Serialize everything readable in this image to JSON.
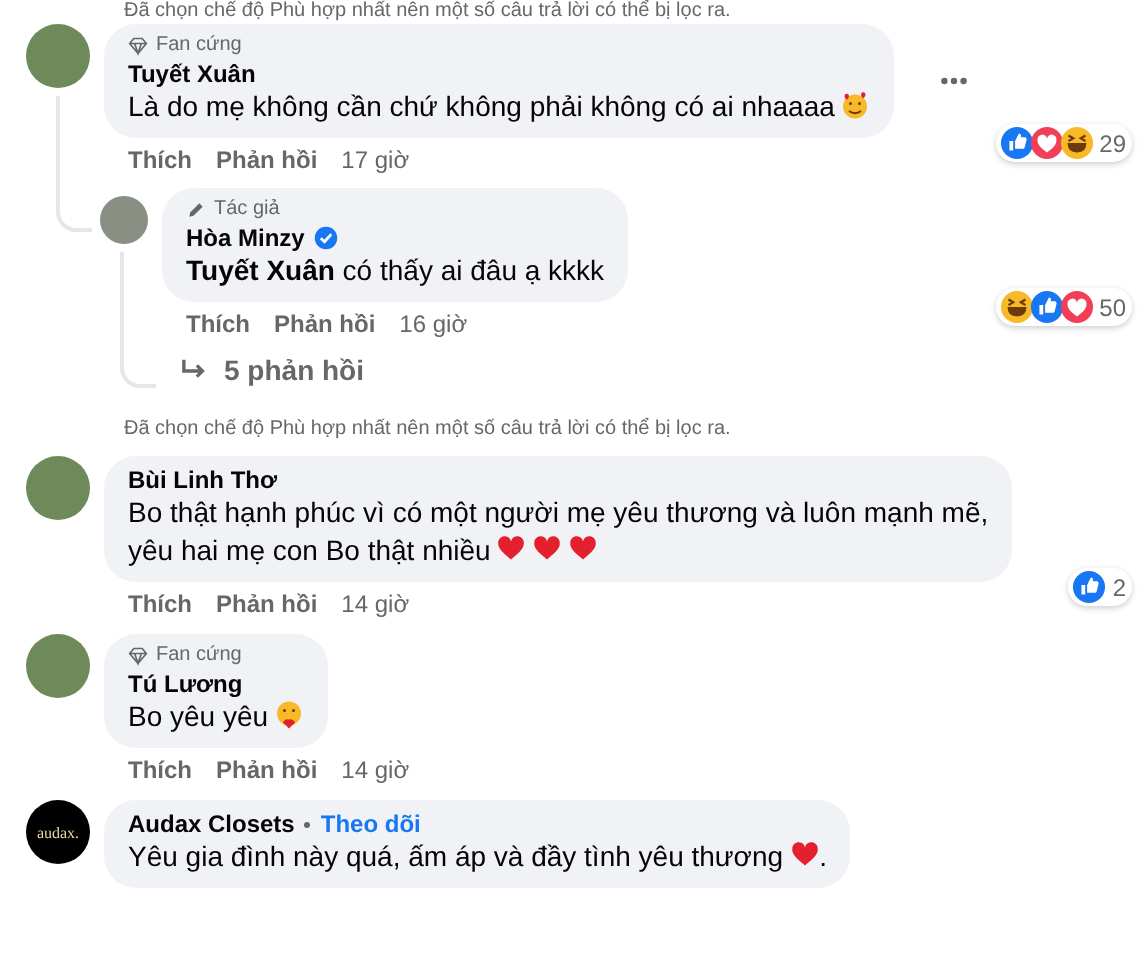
{
  "feed": [
    {
      "kind": "note",
      "text": "Đã chọn chế độ Phù hợp nhất nên một số câu trả lời có thể bị lọc ra."
    },
    {
      "kind": "comment",
      "badge": {
        "kind": "fan",
        "label": "Fan cứng"
      },
      "name": "Tuyết Xuân",
      "verified": false,
      "text": "Là do mẹ không cần chứ không phải không có ai nhaaaa",
      "emoji": [
        {
          "kind": "smiling-hearts"
        }
      ],
      "menu_visible": true,
      "like": "Thích",
      "reply": "Phản hồi",
      "time": "17 giờ",
      "reactions": {
        "icons": [
          {
            "kind": "like"
          },
          {
            "kind": "love"
          },
          {
            "kind": "haha"
          }
        ],
        "count": "29"
      },
      "replies": [
        {
          "badge": {
            "kind": "author",
            "label": "Tác giả"
          },
          "name": "Hòa Minzy",
          "verified": true,
          "text": "**Tuyết Xuân** có thấy ai đâu ạ kkkk",
          "like": "Thích",
          "reply": "Phản hồi",
          "time": "16 giờ",
          "reactions": {
            "icons": [
              {
                "kind": "haha"
              },
              {
                "kind": "like"
              },
              {
                "kind": "love"
              }
            ],
            "count": "50"
          }
        }
      ],
      "more_replies": "5 phản hồi"
    },
    {
      "kind": "note",
      "text": "Đã chọn chế độ Phù hợp nhất nên một số câu trả lời có thể bị lọc ra."
    },
    {
      "kind": "comment",
      "name": "Bùi Linh Thơ",
      "verified": false,
      "text": "Bo thật hạnh phúc vì có một người mẹ yêu thương và luôn mạnh mẽ,",
      "text_2": "yêu hai mẹ con Bo thật nhiều",
      "emoji": [
        {
          "kind": "heart"
        },
        {
          "kind": "heart"
        },
        {
          "kind": "heart"
        }
      ],
      "menu_visible": false,
      "like": "Thích",
      "reply": "Phản hồi",
      "time": "14 giờ",
      "reactions": {
        "icons": [
          {
            "kind": "like"
          }
        ],
        "count": "2"
      }
    },
    {
      "kind": "comment",
      "badge": {
        "kind": "fan",
        "label": "Fan cứng"
      },
      "name": "Tú Lương",
      "verified": false,
      "text": "Bo yêu yêu",
      "emoji": [
        {
          "kind": "hugging"
        }
      ],
      "menu_visible": false,
      "like": "Thích",
      "reply": "Phản hồi",
      "time": "14 giờ"
    },
    {
      "kind": "comment",
      "avatar_text": "audax.",
      "name": "Audax Closets",
      "follow": "Theo dõi",
      "verified": false,
      "text": "Yêu gia đình này quá, ấm áp và đầy tình yêu thương",
      "emoji": [
        {
          "kind": "heart"
        }
      ],
      "text_end": ".",
      "menu_visible": false
    }
  ]
}
